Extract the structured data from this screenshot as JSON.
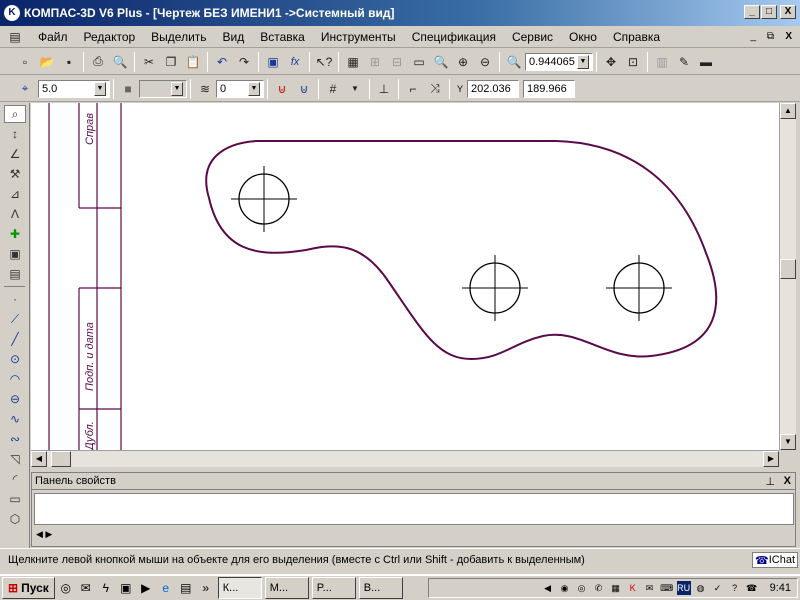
{
  "window": {
    "title": "КОМПАС-3D V6 Plus - [Чертеж БЕЗ ИМЕНИ1 ->Системный вид]",
    "min_label": "_",
    "max_label": "□",
    "close_label": "X"
  },
  "menu": {
    "items": [
      "Файл",
      "Редактор",
      "Выделить",
      "Вид",
      "Вставка",
      "Инструменты",
      "Спецификация",
      "Сервис",
      "Окно",
      "Справка"
    ],
    "doc_min": "_",
    "doc_restore": "⧉",
    "doc_close": "X"
  },
  "toolbar1": {
    "zoom_value": "0.944065"
  },
  "toolbar2": {
    "line_width": "5.0",
    "layer_value": "0",
    "x_label": "Y",
    "x_value": "202.036",
    "y_value": "189.966"
  },
  "drawing": {
    "frame_text_top": "Справ",
    "frame_text_mid": "Подп. и дата",
    "frame_text_bottom": "Дубл.",
    "outline_color": "#5a0a4a"
  },
  "properties_panel": {
    "title": "Панель свойств",
    "pin_icon": "pin-icon",
    "close_label": "X"
  },
  "status": {
    "text": "Щелкните левой кнопкой мыши на объекте для его выделения (вместе с Ctrl или Shift - добавить к выделенным)",
    "chat_label": "IChat"
  },
  "taskbar": {
    "start_label": "Пуск",
    "tasks": [
      "К...",
      "M...",
      "P...",
      "B..."
    ],
    "language": "RU",
    "clock": "9:41"
  }
}
